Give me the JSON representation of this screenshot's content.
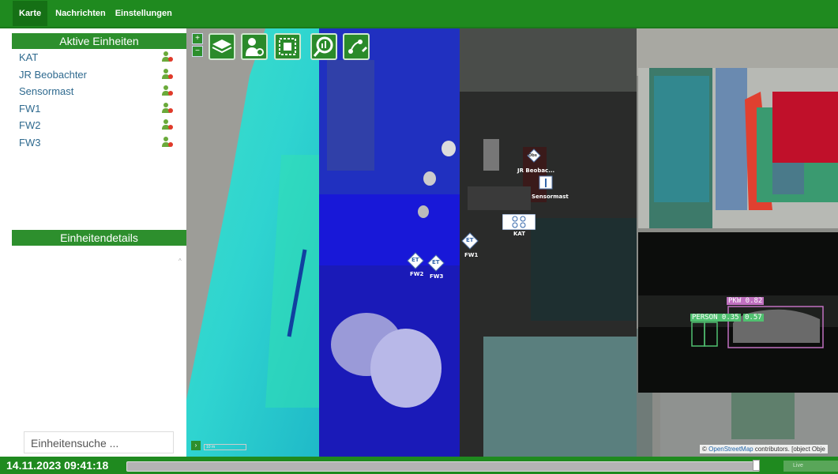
{
  "nav": {
    "tabs": [
      {
        "label": "Karte",
        "active": true
      },
      {
        "label": "Nachrichten",
        "active": false
      },
      {
        "label": "Einstellungen",
        "active": false
      }
    ]
  },
  "sidebar": {
    "active_units_title": "Aktive Einheiten",
    "units": [
      {
        "label": "KAT"
      },
      {
        "label": "JR Beobachter"
      },
      {
        "label": "Sensormast"
      },
      {
        "label": "FW1"
      },
      {
        "label": "FW2"
      },
      {
        "label": "FW3"
      }
    ],
    "details_title": "Einheitendetails",
    "search_placeholder": "Einheitensuche ..."
  },
  "map": {
    "markers": {
      "obs_label": "JR Beobac...",
      "obs_icon_text": "Obs",
      "sensormast_label": "Sensormast",
      "kat_label": "KAT",
      "fw1_label": "FW1",
      "fw2_label": "FW2",
      "fw3_label": "FW3",
      "et_text": "ET"
    },
    "scale_label": "10 m",
    "attribution_prefix": "©",
    "attribution_link": "OpenStreetMap",
    "attribution_suffix": " contributors. [object Obje",
    "detections": [
      {
        "label": "PKW 0.82",
        "color": "#c070c0"
      },
      {
        "label": "PERSON 0.35",
        "color": "#50c070"
      },
      {
        "label": "0.57",
        "color": "#50c070"
      }
    ]
  },
  "status": {
    "timestamp": "14.11.2023 09:41:18",
    "live_label": "Live"
  },
  "colors": {
    "brand_green": "#1f8a1f",
    "link_blue": "#2f6a8f"
  }
}
